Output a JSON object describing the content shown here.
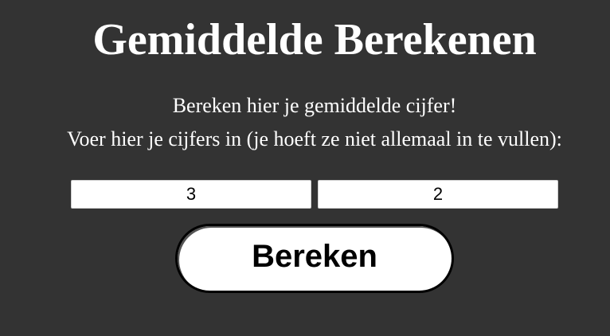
{
  "page": {
    "title": "Gemiddelde Berekenen",
    "subtitle": "Bereken hier je gemiddelde cijfer!",
    "instruction": "Voer hier je cijfers in (je hoeft ze niet allemaal in te vullen):"
  },
  "inputs": {
    "grade_1": {
      "value": "3"
    },
    "grade_2": {
      "value": "2"
    }
  },
  "button": {
    "label": "Bereken"
  },
  "colors": {
    "background": "#333333",
    "text": "#ffffff",
    "input_background": "#ffffff",
    "button_background": "#ffffff",
    "button_border": "#000000"
  }
}
